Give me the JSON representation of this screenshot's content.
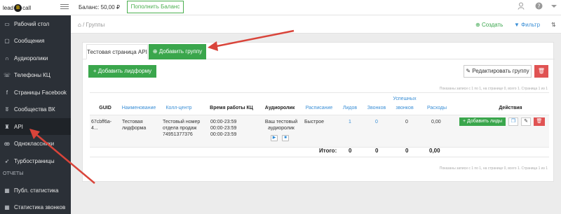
{
  "topbar": {
    "logo_left": "lead",
    "logo_mark": "B",
    "logo_right": "call",
    "balance": "Баланс: 50,00 ₽",
    "topup_button": "Пополнить Баланс",
    "user_icon": "user-icon",
    "help_icon": "help-icon",
    "caret_icon": "caret-down-icon"
  },
  "sidebar": {
    "items": [
      {
        "label": "Рабочий стол",
        "icon": "desktop-icon"
      },
      {
        "label": "Сообщения",
        "icon": "message-icon"
      },
      {
        "label": "Аудиоролики",
        "icon": "headphones-icon"
      },
      {
        "label": "Телефоны КЦ",
        "icon": "phone-icon"
      },
      {
        "label": "Страницы Facebook",
        "icon": "facebook-icon"
      },
      {
        "label": "Сообщества ВК",
        "icon": "vk-icon"
      },
      {
        "label": "API",
        "icon": "api-icon"
      },
      {
        "label": "Одноклассники",
        "icon": "ok-icon"
      },
      {
        "label": "Турбостраницы",
        "icon": "rocket-icon"
      }
    ],
    "section_reports": "ОТЧЕТЫ",
    "report_items": [
      {
        "label": "Публ. статистика",
        "icon": "chart-icon"
      },
      {
        "label": "Статистика звонков",
        "icon": "chart-icon"
      }
    ]
  },
  "breadcrumb": {
    "separator": "/",
    "current": "Группы",
    "create": "Создать",
    "filter": "Фильтр"
  },
  "tabs": {
    "api_page": "Тестовая страница API",
    "add_group": "Добавить группу"
  },
  "toolbar": {
    "add_leadform": "+ Добавить лидформу",
    "edit_group": "Редактировать группу"
  },
  "pager_text": "Показаны записи с 1 по 1, на странице 0, всего 1. Страница 1 из 1",
  "table": {
    "headers": {
      "guid": "GUID",
      "name": "Наименование",
      "callcenter": "Колл-центр",
      "worktime": "Время работы КЦ",
      "audio": "Аудиоролик",
      "schedule": "Расписание",
      "leads": "Лидов",
      "calls": "Звонков",
      "success_1": "Успешных",
      "success_2": "звонков",
      "expenses": "Расходы",
      "actions": "Действия"
    },
    "row": {
      "guid_1": "67cbff6a-",
      "guid_2": "4...",
      "name_1": "Тестовая",
      "name_2": "лидформа",
      "callcenter_1": "Тестовый номер",
      "callcenter_2": "отдела продаж",
      "callcenter_3": "74951377376",
      "work_1": "00:00-23:59",
      "work_2": "00:00-23:59",
      "work_3": "00:00-23:59",
      "audio_1": "Ваш тестовый",
      "audio_2": "аудиоролик",
      "schedule": "Быстрое",
      "leads": "1",
      "calls": "0",
      "success": "0",
      "expenses": "0,00",
      "add_leads": "+ Добавить лиды"
    },
    "totals": {
      "label": "Итого:",
      "leads": "0",
      "calls": "0",
      "success": "0",
      "expenses": "0,00"
    }
  },
  "colors": {
    "green": "#3aa64c",
    "red": "#e05353",
    "arrow": "#d9443a",
    "sidebar_bg": "#2b3037",
    "link": "#3b8fd6"
  }
}
